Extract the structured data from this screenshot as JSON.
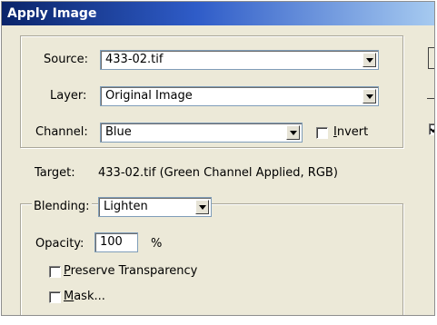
{
  "dialog": {
    "title": "Apply Image",
    "source": {
      "label": "Source:",
      "value": "433-02.tif"
    },
    "layer": {
      "label": "Layer:",
      "value": "Original Image"
    },
    "channel": {
      "label": "Channel:",
      "value": "Blue"
    },
    "invert": {
      "label": "Invert",
      "checked": false
    },
    "target": {
      "label": "Target:",
      "value": "433-02.tif (Green Channel Applied, RGB)"
    },
    "blending": {
      "label": "Blending:",
      "value": "Lighten"
    },
    "opacity": {
      "label": "Opacity:",
      "value": "100",
      "unit": "%"
    },
    "preserve_transparency": {
      "label": "Preserve Transparency",
      "checked": false
    },
    "mask": {
      "label": "Mask...",
      "checked": false
    },
    "side": {
      "preview_checked": true
    }
  }
}
